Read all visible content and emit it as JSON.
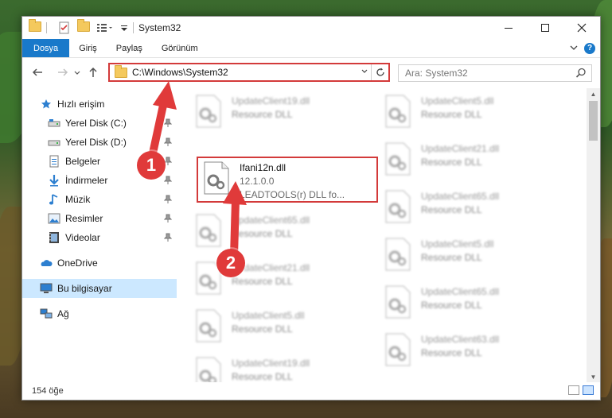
{
  "window": {
    "title": "System32",
    "controls": [
      "minimize",
      "maximize",
      "close"
    ]
  },
  "ribbon": {
    "tabs": [
      {
        "label": "Dosya",
        "active": true
      },
      {
        "label": "Giriş"
      },
      {
        "label": "Paylaş"
      },
      {
        "label": "Görünüm"
      }
    ]
  },
  "nav": {
    "address": "C:\\Windows\\System32",
    "search_placeholder": "Ara: System32"
  },
  "sidebar": {
    "items": [
      {
        "label": "Hızlı erişim",
        "icon": "star-icon"
      },
      {
        "label": "Yerel Disk (C:)",
        "icon": "drive-icon",
        "pinned": true
      },
      {
        "label": "Yerel Disk (D:)",
        "icon": "drive-icon",
        "pinned": true
      },
      {
        "label": "Belgeler",
        "icon": "documents-icon",
        "pinned": true
      },
      {
        "label": "İndirmeler",
        "icon": "downloads-icon",
        "pinned": true
      },
      {
        "label": "Müzik",
        "icon": "music-icon",
        "pinned": true
      },
      {
        "label": "Resimler",
        "icon": "pictures-icon",
        "pinned": true
      },
      {
        "label": "Videolar",
        "icon": "videos-icon",
        "pinned": true
      },
      {
        "label": "OneDrive",
        "icon": "onedrive-icon"
      },
      {
        "label": "Bu bilgisayar",
        "icon": "computer-icon",
        "selected": true
      },
      {
        "label": "Ağ",
        "icon": "network-icon"
      }
    ]
  },
  "files": {
    "highlighted": {
      "name": "Ifani12n.dll",
      "version": "12.1.0.0",
      "description": "LEADTOOLS(r) DLL fo..."
    },
    "left_column": [
      {
        "name": "UpdateClient19.dll",
        "type": "Resource DLL"
      },
      {
        "name": "UpdateClient65.dll",
        "type": "Resource DLL"
      },
      {
        "name": "UpdateClient21.dll",
        "type": "Resource DLL"
      },
      {
        "name": "UpdateClient5.dll",
        "type": "Resource DLL"
      },
      {
        "name": "UpdateClient19.dll",
        "type": "Resource DLL"
      }
    ],
    "right_column": [
      {
        "name": "UpdateClient5.dll",
        "type": "Resource DLL"
      },
      {
        "name": "UpdateClient21.dll",
        "type": "Resource DLL"
      },
      {
        "name": "UpdateClient65.dll",
        "type": "Resource DLL"
      },
      {
        "name": "UpdateClient5.dll",
        "type": "Resource DLL"
      },
      {
        "name": "UpdateClient65.dll",
        "type": "Resource DLL"
      },
      {
        "name": "UpdateClient63.dll",
        "type": "Resource DLL"
      }
    ]
  },
  "status": {
    "count": "154 öğe"
  },
  "markers": {
    "one": "1",
    "two": "2"
  },
  "colors": {
    "accent": "#1979ca",
    "highlight": "#d33a3a",
    "marker": "#e03a3a"
  }
}
